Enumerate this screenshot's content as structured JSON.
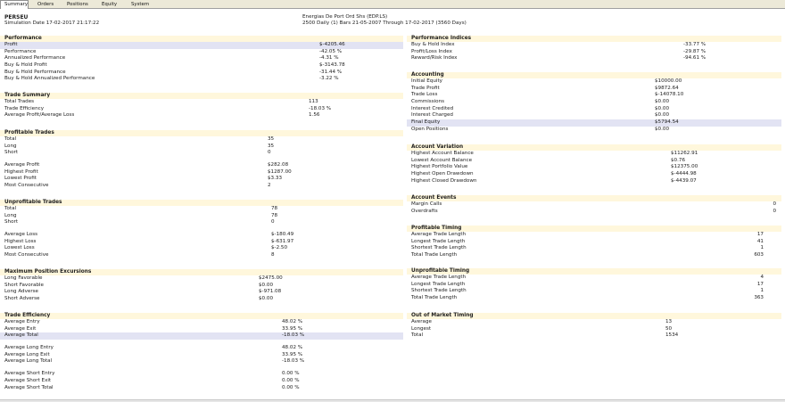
{
  "tabs": [
    "Summary",
    "Orders",
    "Positions",
    "Equity",
    "System"
  ],
  "header": {
    "symbol": "PERSEU",
    "instrument": "Energias De Port Ord Shs (EDP.LS)",
    "sim_date": "Simulation Date 17-02-2017 21:17:22",
    "bars": "2500 Daily (1) Bars 21-05-2007 Through 17-02-2017 (3560 Days)"
  },
  "left": [
    {
      "title": "Performance",
      "rows": [
        [
          "Profit",
          "$-4205.46"
        ],
        [
          "Performance",
          "-42.05 %"
        ],
        [
          "Annualized Performance",
          "-4.31 %"
        ],
        [
          "Buy & Hold Profit",
          "$-3143.78"
        ],
        [
          "Buy & Hold Performance",
          "-31.44 %"
        ],
        [
          "Buy & Hold Annualized Performance",
          "-3.22 %"
        ]
      ]
    },
    {
      "title": "Trade Summary",
      "rows": [
        [
          "Total Trades",
          "113"
        ],
        [
          "Trade Efficiency",
          "-18.03 %"
        ],
        [
          "Average Profit/Average Loss",
          "1.56"
        ]
      ]
    },
    {
      "title": "Profitable Trades",
      "rows": [
        [
          "Total",
          "35"
        ],
        [
          "Long",
          "35"
        ],
        [
          "Short",
          "0"
        ],
        [
          "",
          ""
        ],
        [
          "Average Profit",
          "$282.08"
        ],
        [
          "Highest Profit",
          "$1287.00"
        ],
        [
          "Lowest Profit",
          "$3.33"
        ],
        [
          "Most Consecutive",
          "2"
        ]
      ]
    },
    {
      "title": "Unprofitable Trades",
      "rows": [
        [
          "Total",
          "78"
        ],
        [
          "Long",
          "78"
        ],
        [
          "Short",
          "0"
        ],
        [
          "",
          ""
        ],
        [
          "Average Loss",
          "$-180.49"
        ],
        [
          "Highest Loss",
          "$-631.97"
        ],
        [
          "Lowest Loss",
          "$-2.50"
        ],
        [
          "Most Consecutive",
          "8"
        ]
      ]
    },
    {
      "title": "Maximum Position Excursions",
      "rows": [
        [
          "Long Favorable",
          "$2475.00"
        ],
        [
          "Short Favorable",
          "$0.00"
        ],
        [
          "Long Adverse",
          "$-971.08"
        ],
        [
          "Short Adverse",
          "$0.00"
        ]
      ]
    },
    {
      "title": "Trade Efficiency",
      "rows": [
        [
          "Average Entry",
          "48.02 %"
        ],
        [
          "Average Exit",
          "33.95 %"
        ],
        [
          "Average Total",
          "-18.03 %"
        ],
        [
          "",
          ""
        ],
        [
          "Average Long Entry",
          "48.02 %"
        ],
        [
          "Average Long Exit",
          "33.95 %"
        ],
        [
          "Average Long Total",
          "-18.03 %"
        ],
        [
          "",
          ""
        ],
        [
          "Average Short Entry",
          "0.00 %"
        ],
        [
          "Average Short Exit",
          "0.00 %"
        ],
        [
          "Average Short Total",
          "0.00 %"
        ]
      ]
    }
  ],
  "right": [
    {
      "title": "Performance Indices",
      "rows": [
        [
          "Buy & Hold Index",
          "-33.77 %"
        ],
        [
          "Profit/Loss Index",
          "-29.87 %"
        ],
        [
          "Reward/Risk Index",
          "-94.61 %"
        ]
      ]
    },
    {
      "title": "Accounting",
      "rows": [
        [
          "Initial Equity",
          "$10000.00"
        ],
        [
          "Trade Profit",
          "$9872.64"
        ],
        [
          "Trade Loss",
          "$-14078.10"
        ],
        [
          "Commissions",
          "$0.00"
        ],
        [
          "Interest Credited",
          "$0.00"
        ],
        [
          "Interest Charged",
          "$0.00"
        ],
        [
          "Final Equity",
          "$5794.54"
        ],
        [
          "Open Positions",
          "$0.00"
        ]
      ]
    },
    {
      "title": "Account Variation",
      "rows": [
        [
          "Highest Account Balance",
          "$11262.91"
        ],
        [
          "Lowest Account Balance",
          "$0.76"
        ],
        [
          "Highest Portfolio Value",
          "$12375.00"
        ],
        [
          "Highest Open Drawdown",
          "$-4444.98"
        ],
        [
          "Highest Closed Drawdown",
          "$-4439.07"
        ]
      ]
    },
    {
      "title": "Account Events",
      "rows": [
        [
          "Margin Calls",
          "0"
        ],
        [
          "Overdrafts",
          "0"
        ]
      ]
    },
    {
      "title": "Profitable Timing",
      "rows": [
        [
          "Average Trade Length",
          "17"
        ],
        [
          "Longest Trade Length",
          "41"
        ],
        [
          "Shortest Trade Length",
          "1"
        ],
        [
          "Total Trade Length",
          "603"
        ]
      ]
    },
    {
      "title": "Unprofitable Timing",
      "rows": [
        [
          "Average Trade Length",
          "4"
        ],
        [
          "Longest Trade Length",
          "17"
        ],
        [
          "Shortest Trade Length",
          "1"
        ],
        [
          "Total Trade Length",
          "363"
        ]
      ]
    },
    {
      "title": "Out of Market Timing",
      "rows": [
        [
          "Average",
          "13"
        ],
        [
          "Longest",
          "50"
        ],
        [
          "Total",
          "1534"
        ]
      ]
    }
  ]
}
